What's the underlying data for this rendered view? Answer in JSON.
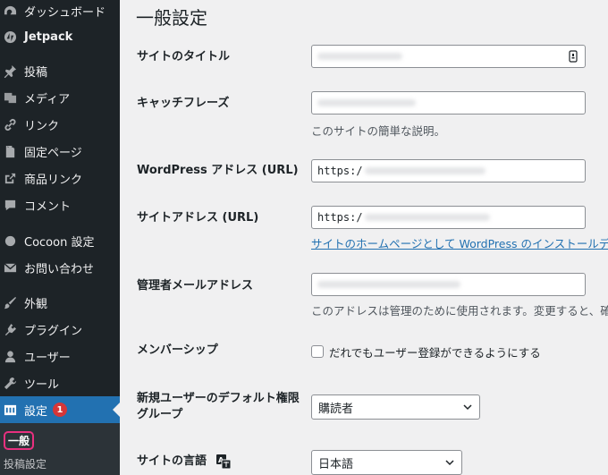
{
  "sidebar": {
    "items": [
      {
        "label": "ダッシュボード",
        "icon": "dashboard-icon"
      },
      {
        "label": "Jetpack",
        "icon": "jetpack-icon"
      },
      {
        "label": "投稿",
        "icon": "pin-icon"
      },
      {
        "label": "メディア",
        "icon": "media-icon"
      },
      {
        "label": "リンク",
        "icon": "link-icon"
      },
      {
        "label": "固定ページ",
        "icon": "page-icon"
      },
      {
        "label": "商品リンク",
        "icon": "external-icon"
      },
      {
        "label": "コメント",
        "icon": "comment-icon"
      },
      {
        "label": "Cocoon 設定",
        "icon": "circle-icon"
      },
      {
        "label": "お問い合わせ",
        "icon": "mail-icon"
      },
      {
        "label": "外観",
        "icon": "brush-icon"
      },
      {
        "label": "プラグイン",
        "icon": "plugin-icon"
      },
      {
        "label": "ユーザー",
        "icon": "user-icon"
      },
      {
        "label": "ツール",
        "icon": "wrench-icon"
      },
      {
        "label": "設定",
        "icon": "settings-icon",
        "badge": "1"
      }
    ],
    "submenu": [
      "一般",
      "投稿設定"
    ]
  },
  "main": {
    "title": "一般設定",
    "site_title": {
      "label": "サイトのタイトル"
    },
    "tagline": {
      "label": "キャッチフレーズ",
      "desc": "このサイトの簡単な説明。"
    },
    "wp_address": {
      "label": "WordPress アドレス (URL)",
      "value": "https:/"
    },
    "site_address": {
      "label": "サイトアドレス (URL)",
      "value": "https:/",
      "link": "サイトのホームページとして WordPress のインストールディ"
    },
    "admin_email": {
      "label": "管理者メールアドレス",
      "desc": "このアドレスは管理のために使用されます。変更すると、確"
    },
    "membership": {
      "label": "メンバーシップ",
      "checkbox_label": "だれでもユーザー登録ができるようにする"
    },
    "default_role": {
      "label_line1": "新規ユーザーのデフォルト権限",
      "label_line2": "グループ",
      "value": "購読者"
    },
    "site_language": {
      "label": "サイトの言語",
      "value": "日本語"
    }
  }
}
